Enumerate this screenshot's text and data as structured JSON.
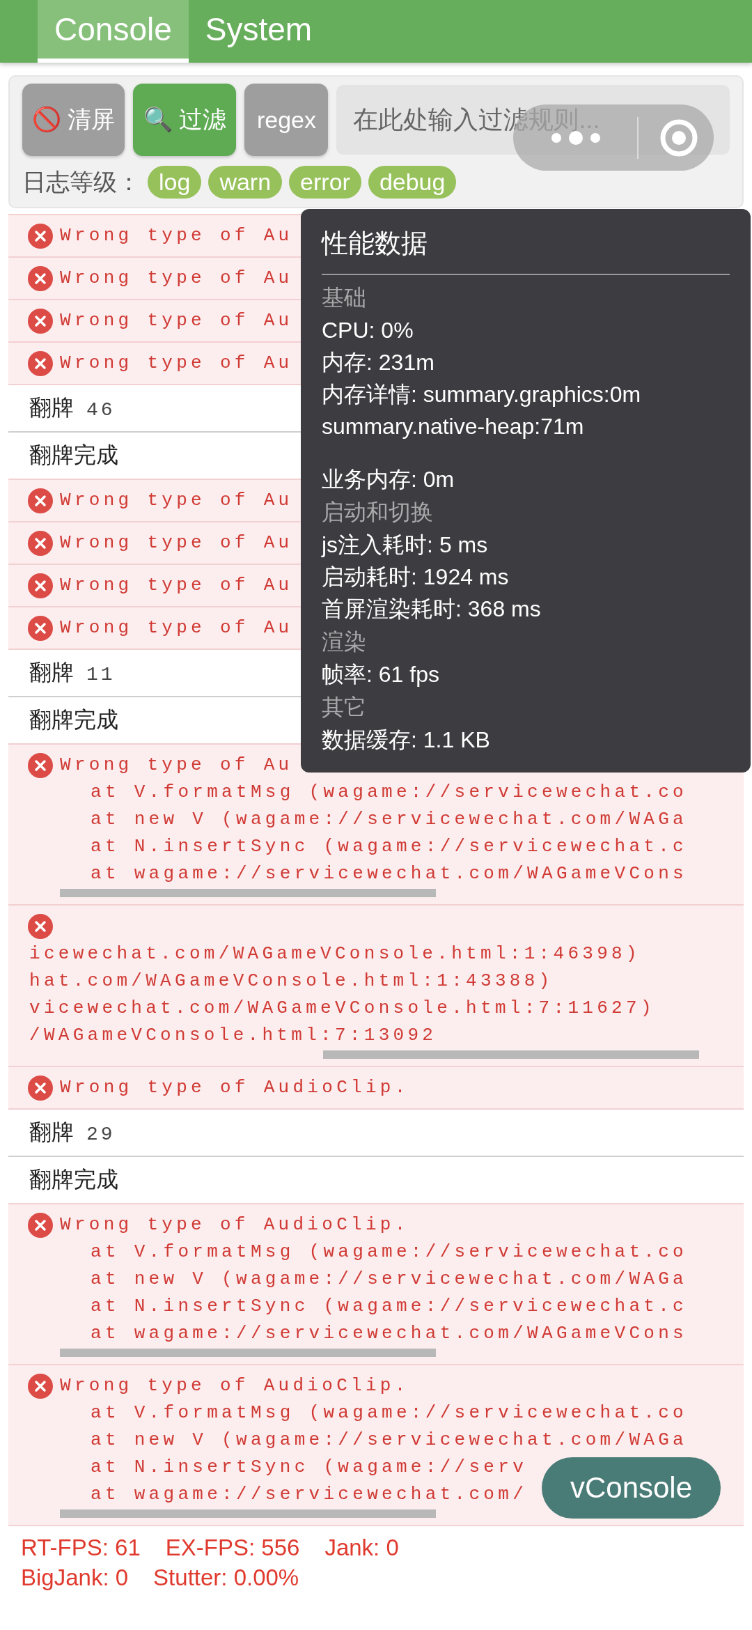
{
  "tabs": [
    {
      "label": "Console",
      "selected": true
    },
    {
      "label": "System",
      "selected": false
    }
  ],
  "toolbar": {
    "buttons": [
      {
        "label": "🚫 清屏",
        "kind": "plain"
      },
      {
        "label": "🔍 过滤",
        "kind": "primary"
      },
      {
        "label": "regex",
        "kind": "plain"
      }
    ],
    "filter": {
      "placeholder": "在此处输入过滤规则..."
    }
  },
  "levels": {
    "label": "日志等级：",
    "pills": [
      {
        "label": "log",
        "selected": true
      },
      {
        "label": "warn",
        "selected": true
      },
      {
        "label": "error",
        "selected": true
      },
      {
        "label": "debug",
        "selected": true
      }
    ]
  },
  "fps_overlay": [
    "RT-FPS: 61",
    "EX-FPS: 556",
    "Jank: 0",
    "BigJank: 0",
    "Stutter: 0.00%"
  ],
  "logs": [
    {
      "kind": "error",
      "lines": [
        "Wrong type of Au"
      ]
    },
    {
      "kind": "error",
      "lines": [
        "Wrong type of Au"
      ]
    },
    {
      "kind": "error",
      "lines": [
        "Wrong type of Au"
      ]
    },
    {
      "kind": "error",
      "lines": [
        "Wrong type of Au"
      ]
    },
    {
      "kind": "log",
      "text": "翻牌",
      "count": "46"
    },
    {
      "kind": "log",
      "text": "翻牌完成"
    },
    {
      "kind": "error",
      "lines": [
        "Wrong type of Au"
      ]
    },
    {
      "kind": "error",
      "lines": [
        "Wrong type of Au"
      ]
    },
    {
      "kind": "error",
      "lines": [
        "Wrong type of Au"
      ]
    },
    {
      "kind": "error",
      "lines": [
        "Wrong type of Au"
      ]
    },
    {
      "kind": "log",
      "text": "翻牌",
      "count": "11"
    },
    {
      "kind": "log",
      "text": "翻牌完成"
    },
    {
      "kind": "error",
      "scrollbar": true,
      "scrolled_right": false,
      "lines": [
        "Wrong type of Au",
        "at V.formatMsg (wagame://servicewechat.co",
        "at new V (wagame://servicewechat.com/WAGa",
        "at N.insertSync (wagame://servicewechat.c",
        "at wagame://servicewechat.com/WAGameVCons"
      ]
    },
    {
      "kind": "error",
      "scrollbar": true,
      "scrolled_right": true,
      "lines": [
        "icewechat.com/WAGameVConsole.html:1:46398)",
        "hat.com/WAGameVConsole.html:1:43388)",
        "vicewechat.com/WAGameVConsole.html:7:11627)",
        "/WAGameVConsole.html:7:13092"
      ]
    },
    {
      "kind": "error",
      "lines": [
        "Wrong type of AudioClip."
      ]
    },
    {
      "kind": "log",
      "text": "翻牌",
      "count": "29"
    },
    {
      "kind": "log",
      "text": "翻牌完成"
    },
    {
      "kind": "error",
      "scrollbar": true,
      "scrolled_right": false,
      "lines": [
        "Wrong type of AudioClip.",
        "at V.formatMsg (wagame://servicewechat.co",
        "at new V (wagame://servicewechat.com/WAGa",
        "at N.insertSync (wagame://servicewechat.c",
        "at wagame://servicewechat.com/WAGameVCons"
      ]
    },
    {
      "kind": "error",
      "scrollbar": true,
      "scrolled_right": false,
      "lines": [
        "Wrong type of AudioClip.",
        "at V.formatMsg (wagame://servicewechat.co",
        "at new V (wagame://servicewechat.com/WAGa",
        "at N.insertSync (wagame://serv",
        "at wagame://servicewechat.com/"
      ]
    }
  ],
  "perf_panel": {
    "title": "性能数据",
    "items": [
      {
        "kind": "heading",
        "text": "基础"
      },
      {
        "kind": "stat",
        "lines": [
          "CPU: 0%"
        ]
      },
      {
        "kind": "stat",
        "lines": [
          "内存: 231m"
        ]
      },
      {
        "kind": "stat",
        "lines": [
          "内存详情: summary.graphics:0m",
          "summary.native-heap:71m"
        ]
      },
      {
        "kind": "spacer"
      },
      {
        "kind": "stat",
        "lines": [
          "业务内存: 0m"
        ]
      },
      {
        "kind": "heading",
        "text": "启动和切换"
      },
      {
        "kind": "stat",
        "lines": [
          "js注入耗时: 5 ms"
        ]
      },
      {
        "kind": "stat",
        "lines": [
          "启动耗时: 1924 ms"
        ]
      },
      {
        "kind": "stat",
        "lines": [
          "首屏渲染耗时: 368 ms"
        ]
      },
      {
        "kind": "heading",
        "text": "渲染"
      },
      {
        "kind": "stat",
        "lines": [
          "帧率: 61 fps"
        ]
      },
      {
        "kind": "heading",
        "text": "其它"
      },
      {
        "kind": "stat",
        "lines": [
          "数据缓存: 1.1 KB"
        ]
      }
    ]
  },
  "vconsole_button": {
    "label": "vConsole"
  }
}
